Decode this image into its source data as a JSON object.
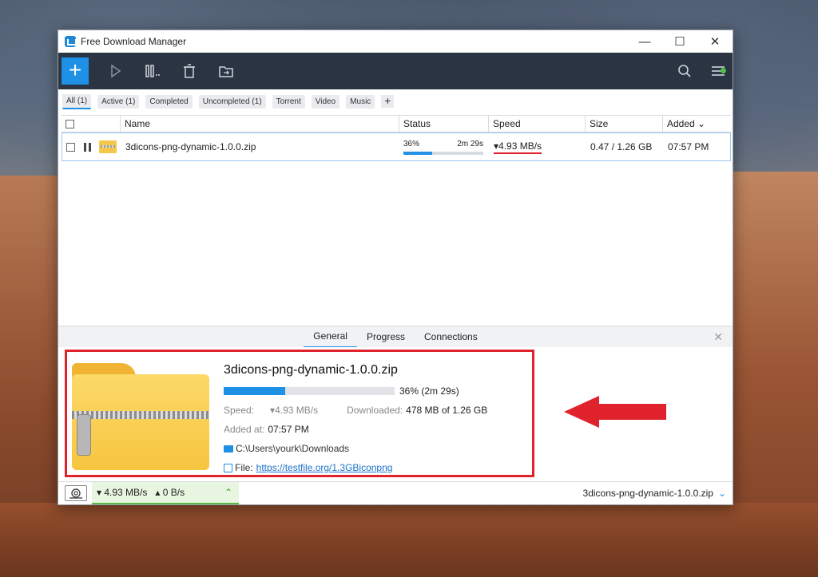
{
  "window": {
    "title": "Free Download Manager"
  },
  "window_controls": {
    "minimize": "—",
    "maximize": "☐",
    "close": "✕"
  },
  "toolbar": {
    "add_label": "+",
    "icons": [
      "play-icon",
      "pause-icon",
      "delete-icon",
      "move-folder-icon",
      "search-icon",
      "menu-icon"
    ],
    "accent": "#1e90e6",
    "background": "#2b3442"
  },
  "filters": {
    "items": [
      "All (1)",
      "Active (1)",
      "Completed",
      "Uncompleted (1)",
      "Torrent",
      "Video",
      "Music"
    ],
    "add_label": "+"
  },
  "table": {
    "headers": {
      "name": "Name",
      "status": "Status",
      "speed": "Speed",
      "size": "Size",
      "added": "Added ⌄"
    },
    "row": {
      "name": "3dicons-png-dynamic-1.0.0.zip",
      "percent": "36%",
      "remaining": "2m 29s",
      "progress": 0.36,
      "speed": "▾4.93 MB/s",
      "size": "0.47 / 1.26 GB",
      "added": "07:57 PM"
    }
  },
  "details": {
    "tabs": [
      "General",
      "Progress",
      "Connections"
    ],
    "close": "✕",
    "file_name": "3dicons-png-dynamic-1.0.0.zip",
    "progress": 0.36,
    "progress_text": "36% (2m 29s)",
    "speed_label": "Speed:",
    "speed_value": "▾4.93 MB/s",
    "downloaded_label": "Downloaded:",
    "downloaded_value": "478 MB of 1.26 GB",
    "added_label": "Added at:",
    "added_value": "07:57 PM",
    "folder": "C:\\Users\\yourk\\Downloads",
    "file_label": "File:",
    "file_url": "https://testfile.org/1.3GBiconpng"
  },
  "statusbar": {
    "down_speed": "▾ 4.93 MB/s",
    "up_speed": "▴ 0 B/s",
    "current_file": "3dicons-png-dynamic-1.0.0.zip",
    "chevron": "⌃",
    "chevron_down": "⌄"
  },
  "annotation_color": "#e0222d"
}
